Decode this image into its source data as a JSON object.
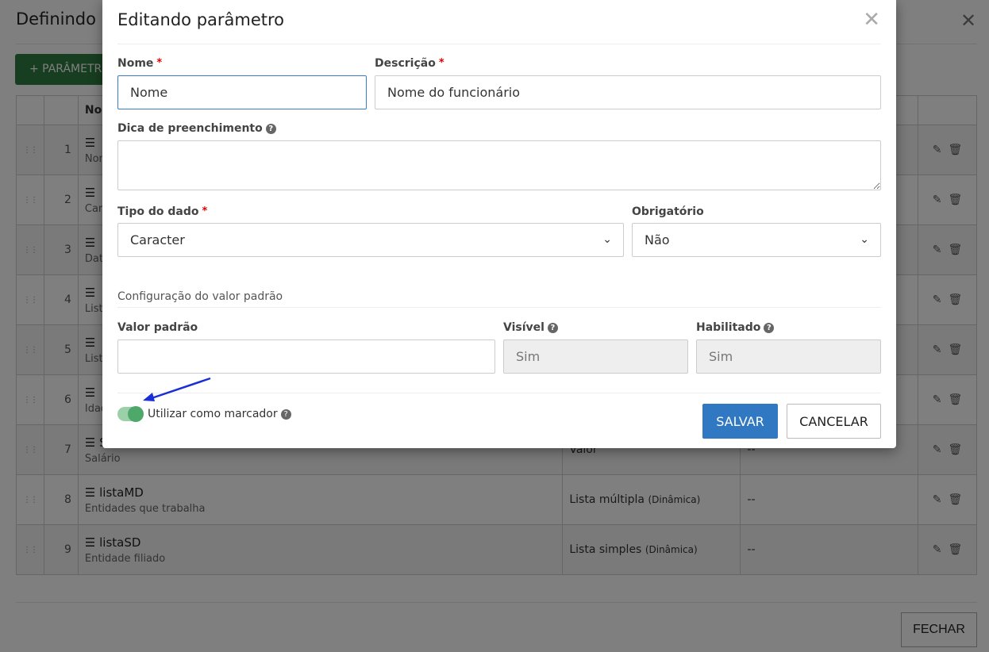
{
  "background": {
    "title": "Definindo",
    "add_button": "+ PARÂMETR",
    "table": {
      "headers": [
        "",
        "",
        "Nom",
        "",
        "",
        ""
      ],
      "rows": [
        {
          "num": "1",
          "name": "",
          "desc": "Nom",
          "type": "",
          "type_note": "",
          "default": ""
        },
        {
          "num": "2",
          "name": "",
          "desc": "Carg",
          "type": "",
          "type_note": "",
          "default": ""
        },
        {
          "num": "3",
          "name": "",
          "desc": "Data",
          "type": "",
          "type_note": "",
          "default": ""
        },
        {
          "num": "4",
          "name": "",
          "desc": "Lista",
          "type": "",
          "type_note": "",
          "default": ""
        },
        {
          "num": "5",
          "name": "",
          "desc": "Lista",
          "type": "",
          "type_note": "",
          "default": ""
        },
        {
          "num": "6",
          "name": "",
          "desc": "Idad",
          "type": "",
          "type_note": "",
          "default": ""
        },
        {
          "num": "7",
          "name": "S",
          "desc": "Salário",
          "type": "Valor",
          "type_note": "",
          "default": "--"
        },
        {
          "num": "8",
          "name": "listaMD",
          "desc": "Entidades que trabalha",
          "type": "Lista múltipla",
          "type_note": "(Dinâmica)",
          "default": "--"
        },
        {
          "num": "9",
          "name": "listaSD",
          "desc": "Entidade filiado",
          "type": "Lista simples",
          "type_note": "(Dinâmica)",
          "default": "--"
        }
      ]
    },
    "close_button": "FECHAR"
  },
  "modal": {
    "title": "Editando parâmetro",
    "nome": {
      "label": "Nome",
      "value": "Nome"
    },
    "descricao": {
      "label": "Descrição",
      "value": "Nome do funcionário"
    },
    "dica": {
      "label": "Dica de preenchimento",
      "value": ""
    },
    "tipo": {
      "label": "Tipo do dado",
      "value": "Caracter"
    },
    "obrigatorio": {
      "label": "Obrigatório",
      "value": "Não"
    },
    "section": "Configuração do valor padrão",
    "valor_padrao": {
      "label": "Valor padrão",
      "value": ""
    },
    "visivel": {
      "label": "Visível",
      "value": "Sim"
    },
    "habilitado": {
      "label": "Habilitado",
      "value": "Sim"
    },
    "marcador": {
      "label": "Utilizar como marcador",
      "checked": true
    },
    "save": "SALVAR",
    "cancel": "CANCELAR"
  },
  "colors": {
    "primary": "#3079c2",
    "success": "#2e7d40",
    "toggle": "#4ea86a",
    "required": "#dd0000",
    "annotation_arrow": "#1a2fd6"
  }
}
